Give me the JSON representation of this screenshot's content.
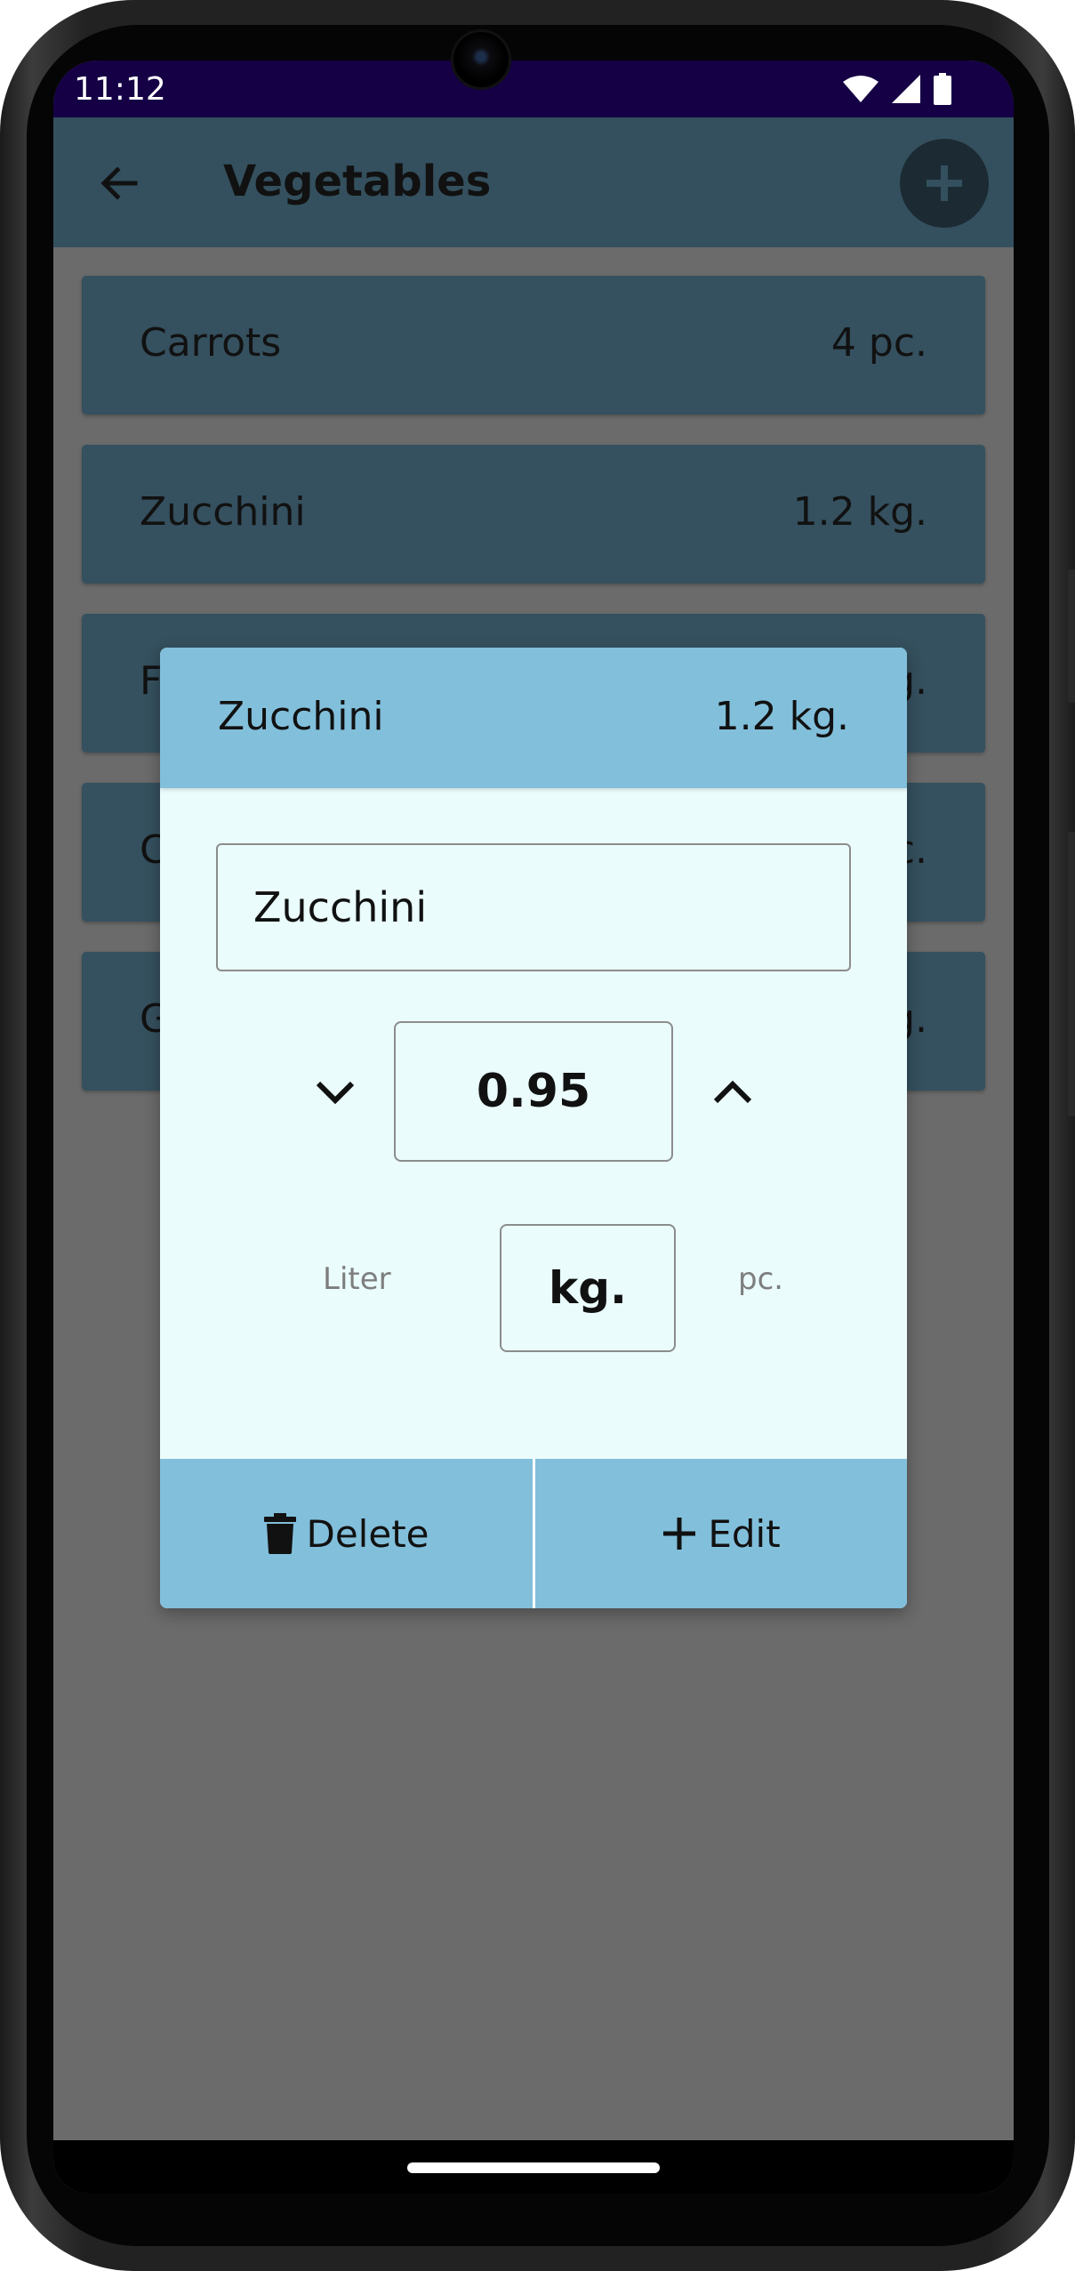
{
  "status": {
    "time": "11:12",
    "icons": [
      "wifi-icon",
      "signal-icon",
      "battery-icon"
    ]
  },
  "appbar": {
    "title": "Vegetables",
    "back_icon": "arrow-left-icon",
    "add_icon": "plus-icon"
  },
  "list": {
    "items": [
      {
        "name": "Carrots",
        "qty": "4 pc."
      },
      {
        "name": "Zucchini",
        "qty": "1.2 kg."
      },
      {
        "name": "F",
        "qty": "g."
      },
      {
        "name": "C",
        "qty": "c."
      },
      {
        "name": "G",
        "qty": "g."
      }
    ]
  },
  "dialog": {
    "header_name": "Zucchini",
    "header_qty": "1.2 kg.",
    "name_value": "Zucchini",
    "quantity": "0.95",
    "units": {
      "liter": "Liter",
      "kg": "kg.",
      "pc": "pc.",
      "selected": "kg."
    },
    "delete_label": "Delete",
    "edit_label": "Edit"
  },
  "colors": {
    "status_bar": "#150045",
    "app_bar": "#34505e",
    "list_item": "#35505e",
    "scrim": "#6b6b6b",
    "dialog_bg": "#eafcfc",
    "dialog_accent": "#82bfdb"
  }
}
